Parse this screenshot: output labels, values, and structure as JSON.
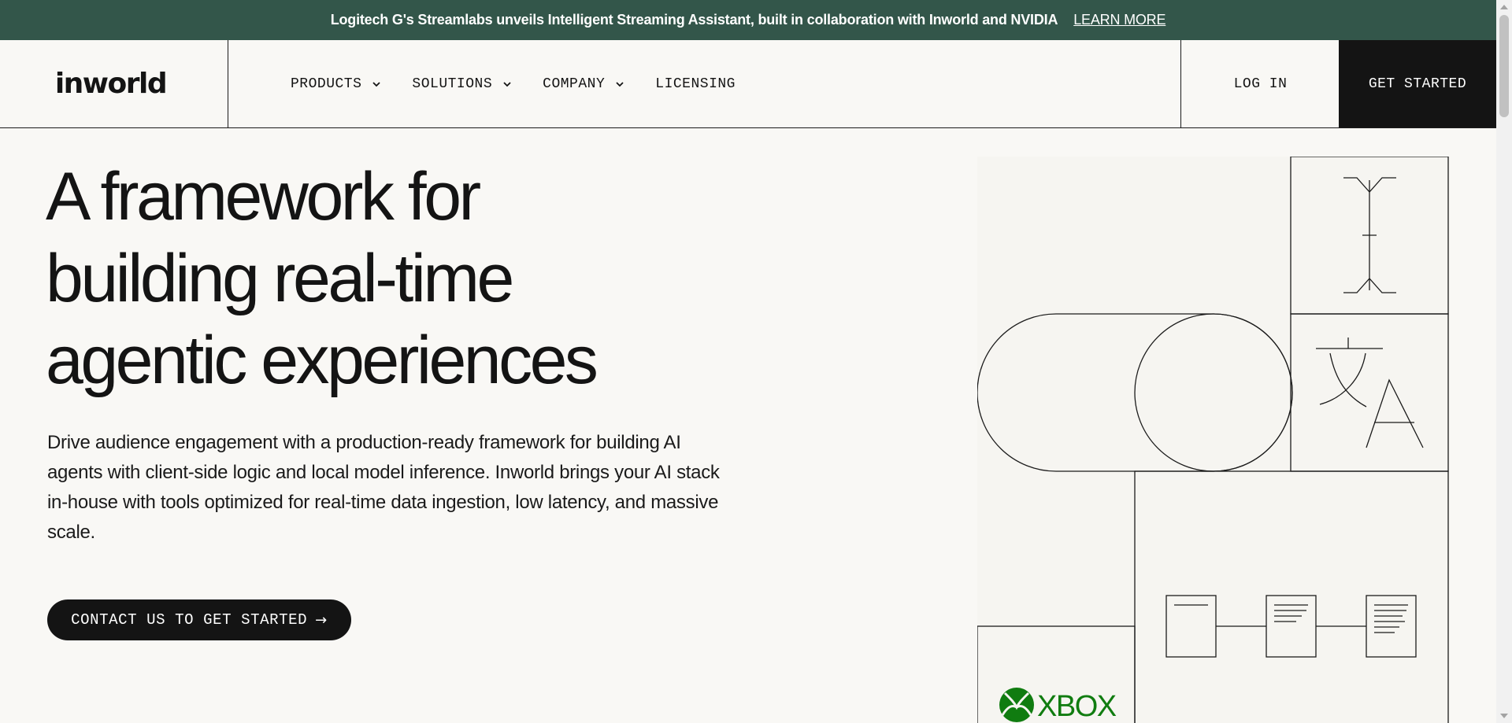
{
  "banner": {
    "text": "Logitech G's Streamlabs unveils Intelligent Streaming Assistant, built in collaboration with Inworld and NVIDIA",
    "link_label": "LEARN MORE"
  },
  "header": {
    "logo_text": "inworld",
    "nav": [
      {
        "label": "PRODUCTS",
        "has_dropdown": true
      },
      {
        "label": "SOLUTIONS",
        "has_dropdown": true
      },
      {
        "label": "COMPANY",
        "has_dropdown": true
      },
      {
        "label": "LICENSING",
        "has_dropdown": false
      }
    ],
    "login_label": "LOG IN",
    "get_started_label": "GET STARTED"
  },
  "hero": {
    "title_lines": [
      "A framework for",
      "building real-time",
      "agentic experiences"
    ],
    "description": "Drive audience engagement with a production-ready framework for building AI agents with client-side logic and local model inference. Inworld brings your AI stack in-house with tools optimized for real-time data ingestion, low latency, and massive scale.",
    "cta_label": "CONTACT US TO GET STARTED",
    "cta_icon": "arrow-right-icon"
  },
  "art": {
    "partner_logo_text": "XBOX",
    "partner_logo_icon": "xbox-sphere-icon",
    "brand_green": "#107c10"
  },
  "colors": {
    "banner_bg": "#33564a",
    "page_bg": "#f9f8f5",
    "ink": "#141414"
  }
}
